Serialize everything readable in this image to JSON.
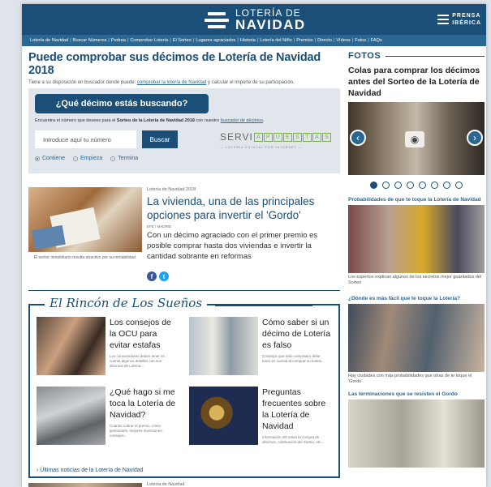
{
  "header": {
    "logo_line1": "LOTERÍA DE",
    "logo_line2": "NAVIDAD",
    "publisher_line1": "PRENSA",
    "publisher_line2": "IBÉRICA"
  },
  "nav": {
    "items": [
      "Lotería de Navidad",
      "Buscar Números",
      "Pedrea",
      "Comprobar Lotería",
      "El Sorteo",
      "Lugares agraciados",
      "Historia",
      "Lotería del Niño",
      "Premios",
      "Directo",
      "Vídeos",
      "Fotos",
      "FAQs"
    ]
  },
  "main": {
    "headline": "Puede comprobar sus décimos de Lotería de Navidad 2018",
    "intro_before": "Tiene a su disposición un buscador donde puede:",
    "intro_link": "comprobar la lotería de Navidad",
    "intro_after": "y calcular el importe de su participación."
  },
  "search": {
    "question": "¿Qué décimo estás buscando?",
    "find_before": "Encuentra el número que desees para el",
    "find_bold": "Sorteo de la Lotería de Navidad 2018",
    "find_middle": "con nuestro",
    "find_link": "buscador de décimos",
    "input_placeholder": "Introduce aquí tu número",
    "button": "Buscar",
    "servi_prefix": "SERVI",
    "servi_letters": [
      "A",
      "P",
      "U",
      "E",
      "S",
      "T",
      "A",
      "S"
    ],
    "servi_sub": "— LOTERÍA ESTATAL POR INTERNET —",
    "options": [
      "Contiene",
      "Empieza",
      "Termina"
    ]
  },
  "article": {
    "tag": "Lotería de Navidad 2018",
    "title": "La vivienda, una de las principales opciones para invertir el 'Gordo'",
    "source": "EFE / MADRID",
    "text": "Con un décimo agraciado con el primer premio es posible comprar hasta dos viviendas e invertir la cantidad sobrante en reformas",
    "image_caption": "El sector inmobiliario resulta atractivo por su rentabilidad.",
    "facebook": "f",
    "twitter": "t"
  },
  "rincon": {
    "title": "El Rincón de Los Sueños",
    "cards": [
      {
        "title": "Los consejos de la OCU para evitar estafas",
        "desc": "Los consumidores deben tener en cuenta algunos detalles con sus décimos de Lotería..."
      },
      {
        "title": "Cómo saber si un décimo de Lotería es falso",
        "desc": "Consejos que todo comprador debe tener en cuenta al comprar su boleto..."
      },
      {
        "title": "¿Qué hago si me toca la Lotería de Navidad?",
        "desc": "Cuando cobrar el premio, cómo gestionarlo, mejores inversiones, consejos..."
      },
      {
        "title": "Preguntas frecuentes sobre la Lotería de Navidad",
        "desc": "Información útil sobre la compra de décimos, celebración del Sorteo, etc..."
      }
    ],
    "more_link": "› Últimas noticias de la Lotería de Navidad"
  },
  "next_article": {
    "tag": "Lotería de Navidad"
  },
  "sidebar": {
    "fotos_label": "FOTOS",
    "fotos_title": "Colas para comprar los décimos antes del Sorteo de la Lotería de Navidad",
    "items": [
      {
        "title": "Probabilidades de que te toque la Lotería de Navidad",
        "caption": "Los expertos explican algunos de los secretos mejor guardados del Sorteo"
      },
      {
        "title": "¿Dónde es más fácil que te toque la Lotería?",
        "caption": "Hay ciudades con más probabilidades que otras de te toque el 'Gordo'."
      },
      {
        "title": "Las terminaciones que se resisten el Gordo",
        "caption": ""
      }
    ]
  }
}
